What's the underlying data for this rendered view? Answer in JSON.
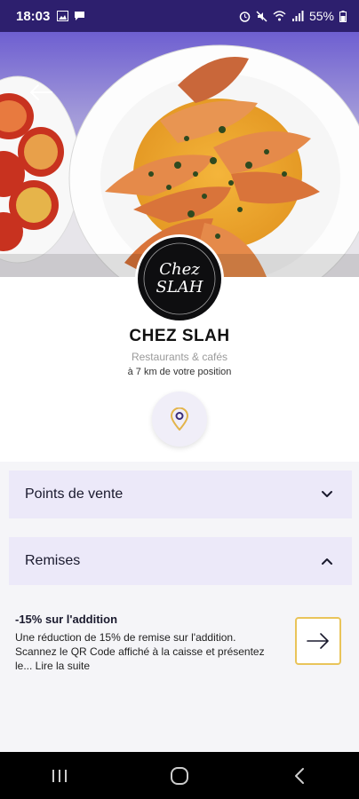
{
  "status_bar": {
    "time": "18:03",
    "battery": "55%"
  },
  "hero": {
    "carousel_dots": 3,
    "active_dot": 0
  },
  "logo": {
    "line1": "Chez",
    "line2": "SLAH"
  },
  "shop": {
    "name": "CHEZ SLAH",
    "category": "Restaurants & cafés",
    "distance": "à 7 km de votre position"
  },
  "sections": {
    "points_de_vente": "Points de vente",
    "remises": "Remises"
  },
  "offer": {
    "title": "-15% sur l'addition",
    "description": "Une réduction de 15% de remise sur l'addition. Scannez le QR Code affiché à la caisse et présentez le... Lire la suite"
  },
  "colors": {
    "status_bar": "#2d1f6e",
    "accordion": "#ece9f9",
    "accent_border": "#e9c45a"
  }
}
